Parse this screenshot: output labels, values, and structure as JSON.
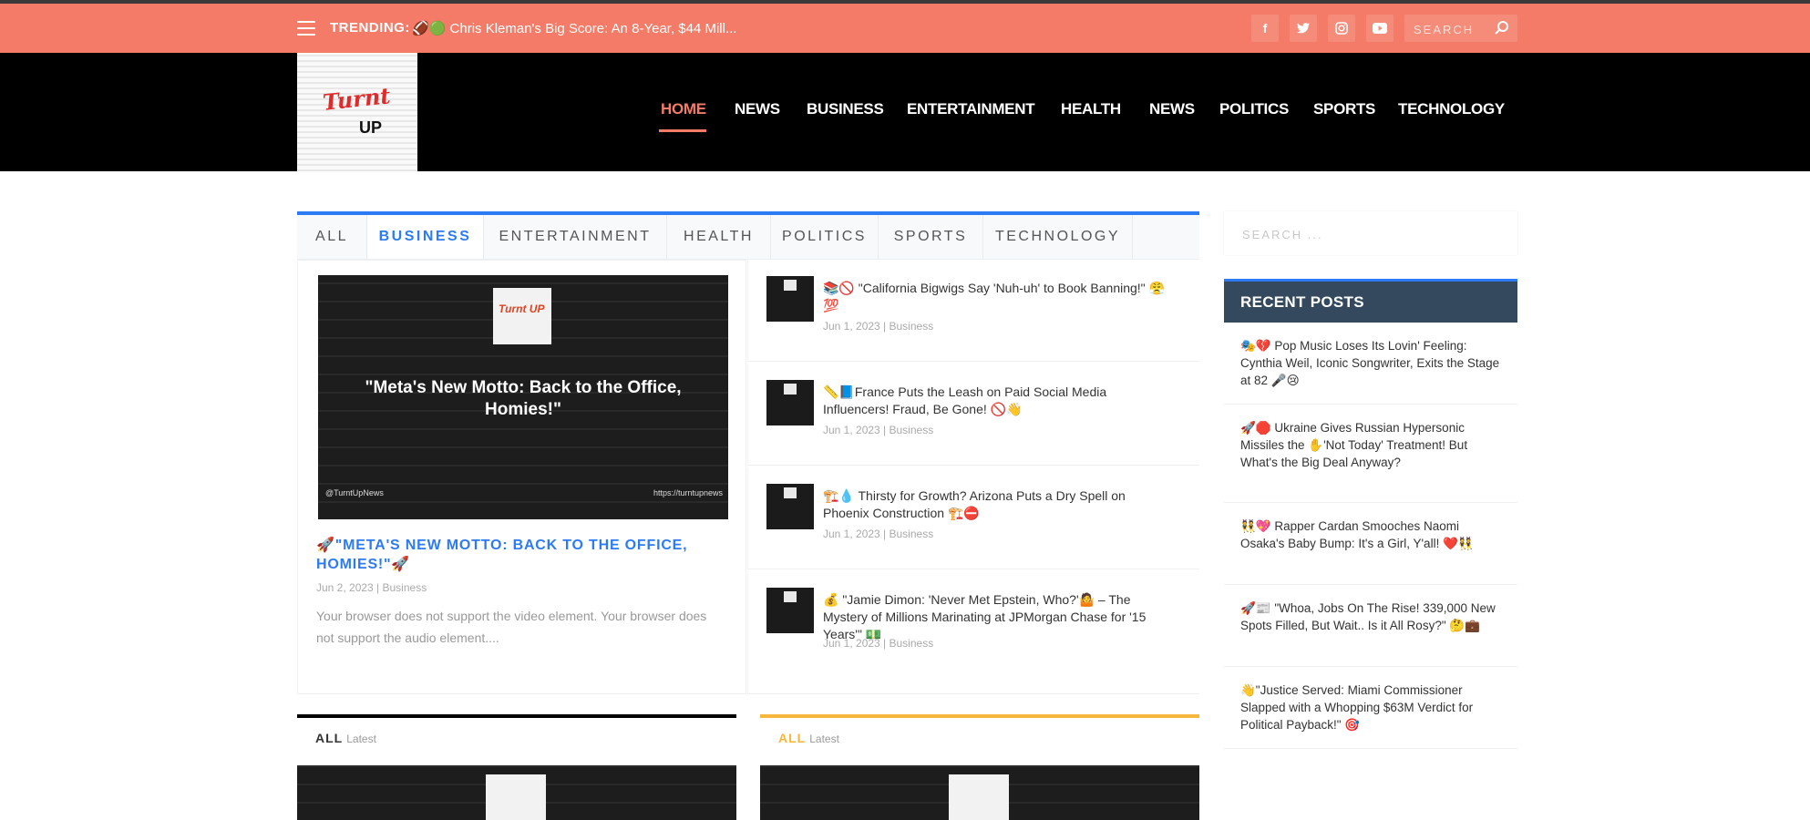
{
  "topbar": {
    "trending_label": "TRENDING:",
    "trending_text": "🏈🟢 Chris Kleman's Big Score: An 8-Year, $44 Mill...",
    "social": [
      "f",
      "t",
      "ig",
      "▶"
    ],
    "search_placeholder": "SEARCH"
  },
  "header": {
    "logo_text_1": "Turnt",
    "logo_text_2": "UP",
    "nav": [
      "HOME",
      "NEWS",
      "BUSINESS",
      "ENTERTAINMENT",
      "HEALTH",
      "NEWS",
      "POLITICS",
      "SPORTS",
      "TECHNOLOGY"
    ]
  },
  "tabs": [
    "ALL",
    "BUSINESS",
    "ENTERTAINMENT",
    "HEALTH",
    "POLITICS",
    "SPORTS",
    "TECHNOLOGY"
  ],
  "feature": {
    "image_badge": "Turnt UP",
    "image_quote": "\"Meta's New Motto: Back to the Office, Homies!\"",
    "image_foot_left": "@TurntUpNews",
    "image_foot_right": "https://turntupnews",
    "title": "🚀\"META'S NEW MOTTO: BACK TO THE OFFICE, HOMIES!\"🚀",
    "meta": "Jun 2, 2023 | Business",
    "excerpt": "Your browser does not support the video element. Your browser does not support the audio element...."
  },
  "side_posts": [
    {
      "title": "📚🚫 \"California Bigwigs Say 'Nuh-uh' to Book Banning!\" 😤💯",
      "meta": "Jun 1, 2023 | Business"
    },
    {
      "title": "📏📘France Puts the Leash on Paid Social Media Influencers! Fraud, Be Gone! 🚫👋",
      "meta": "Jun 1, 2023 | Business"
    },
    {
      "title": "🏗️💧 Thirsty for Growth? Arizona Puts a Dry Spell on Phoenix Construction 🏗️⛔",
      "meta": "Jun 1, 2023 | Business"
    },
    {
      "title": "💰 \"Jamie Dimon: 'Never Met Epstein, Who?'🤷 – The Mystery of Millions Marinating at JPMorgan Chase for '15 Years'\" 💵",
      "meta": "Jun 1, 2023 | Business"
    }
  ],
  "bottom_cards": [
    {
      "head": "ALL",
      "sub": "Latest",
      "color": "#000000"
    },
    {
      "head": "ALL",
      "sub": "Latest",
      "color": "#f6b73c"
    }
  ],
  "sidebar": {
    "search_placeholder": "SEARCH ...",
    "recent_title": "RECENT POSTS",
    "recent": [
      "🎭💔 Pop Music Loses Its Lovin' Feeling: Cynthia Weil, Iconic Songwriter, Exits the Stage at 82 🎤😢",
      "🚀🛑 Ukraine Gives Russian Hypersonic Missiles the ✋'Not Today' Treatment! But What's the Big Deal Anyway?",
      "👯💖 Rapper Cardan Smooches Naomi Osaka's Baby Bump: It's a Girl, Y'all! ❤️👯",
      "🚀📰 \"Whoa, Jobs On The Rise! 339,000 New Spots Filled, But Wait.. Is it All Rosy?\" 🤔💼",
      "👋\"Justice Served: Miami Commissioner Slapped with a Whopping $63M Verdict for Political Payback!\" 🎯"
    ]
  },
  "colors": {
    "accent": "#f47b67",
    "blue": "#2d7bf4",
    "header_bg": "#000000",
    "recent_head": "#34495e"
  }
}
